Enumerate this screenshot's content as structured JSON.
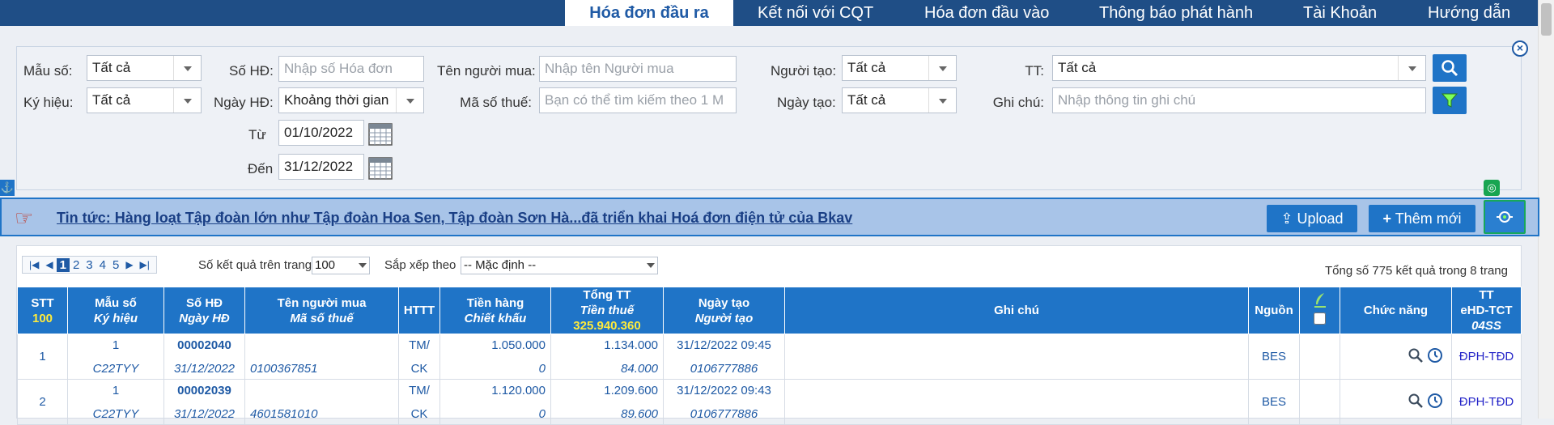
{
  "nav": {
    "tabs": [
      {
        "label": "Hóa đơn đầu ra",
        "active": true
      },
      {
        "label": "Kết nối với CQT"
      },
      {
        "label": "Hóa đơn đầu vào"
      },
      {
        "label": "Thông báo phát hành"
      },
      {
        "label": "Tài Khoản"
      },
      {
        "label": "Hướng dẫn"
      }
    ]
  },
  "filters": {
    "mau_so_label": "Mẫu số:",
    "mau_so_value": "Tất cả",
    "ky_hieu_label": "Ký hiệu:",
    "ky_hieu_value": "Tất cả",
    "so_hd_label": "Số HĐ:",
    "so_hd_placeholder": "Nhập số Hóa đơn",
    "ngay_hd_label": "Ngày HĐ:",
    "ngay_hd_value": "Khoảng thời gian",
    "tu_label": "Từ",
    "tu_value": "01/10/2022",
    "den_label": "Đến",
    "den_value": "31/12/2022",
    "ten_nguoi_mua_label": "Tên người mua:",
    "ten_nguoi_mua_placeholder": "Nhập tên Người mua",
    "ma_so_thue_label": "Mã số thuế:",
    "ma_so_thue_placeholder": "Bạn có thể tìm kiếm theo 1 M",
    "nguoi_tao_label": "Người tạo:",
    "nguoi_tao_value": "Tất cả",
    "ngay_tao_label": "Ngày tạo:",
    "ngay_tao_value": "Tất cả",
    "tt_label": "TT:",
    "tt_value": "Tất cả",
    "ghi_chu_label": "Ghi chú:",
    "ghi_chu_placeholder": "Nhập thông tin ghi chú"
  },
  "news": {
    "text": "Tin tức: Hàng loạt Tập đoàn lớn như Tập đoàn Hoa Sen, Tập đoàn Sơn Hà...đã triển khai Hoá đơn điện tử của Bkav"
  },
  "actions": {
    "upload_label": "Upload",
    "add_label": "Thêm mới"
  },
  "listing": {
    "pages": [
      "1",
      "2",
      "3",
      "4",
      "5"
    ],
    "current_page": "1",
    "per_page_label": "Số kết quả trên trang",
    "per_page_value": "100",
    "sort_label": "Sắp xếp theo",
    "sort_value": "-- Mặc định --",
    "total_text": "Tổng số 775 kết quả trong 8 trang"
  },
  "table": {
    "headers": {
      "stt": "STT",
      "stt_sub": "100",
      "mau_so": "Mẫu số",
      "ky_hieu": "Ký hiệu",
      "so_hd": "Số HĐ",
      "ngay_hd": "Ngày HĐ",
      "ten_nguoi_mua": "Tên người mua",
      "mst": "Mã số thuế",
      "httt": "HTTT",
      "tien_hang": "Tiền hàng",
      "chiet_khau": "Chiết khấu",
      "tong_tt": "Tổng TT",
      "tien_thue": "Tiền thuế",
      "tong_value": "325.940.360",
      "ngay_tao": "Ngày tạo",
      "nguoi_tao": "Người tạo",
      "ghi_chu": "Ghi chú",
      "nguon": "Nguồn",
      "chuc_nang": "Chức năng",
      "tt": "TT",
      "ehd": "eHD-TCT",
      "ss": "04SS"
    },
    "rows": [
      {
        "stt": "1",
        "mau_so": "1",
        "ky_hieu": "C22TYY",
        "so_hd": "00002040",
        "ngay_hd": "31/12/2022",
        "ten": "",
        "mst": "0100367851",
        "httt1": "TM/",
        "httt2": "CK",
        "tien_hang": "1.050.000",
        "chiet_khau": "0",
        "tong_tt": "1.134.000",
        "tien_thue": "84.000",
        "ngay_tao": "31/12/2022 09:45",
        "nguoi_tao": "0106777886",
        "ghi_chu": "",
        "nguon": "BES",
        "tt": "ĐPH-TĐD"
      },
      {
        "stt": "2",
        "mau_so": "1",
        "ky_hieu": "C22TYY",
        "so_hd": "00002039",
        "ngay_hd": "31/12/2022",
        "ten": "",
        "mst": "4601581010",
        "httt1": "TM/",
        "httt2": "CK",
        "tien_hang": "1.120.000",
        "chiet_khau": "0",
        "tong_tt": "1.209.600",
        "tien_thue": "89.600",
        "ngay_tao": "31/12/2022 09:43",
        "nguoi_tao": "0106777886",
        "ghi_chu": "",
        "nguon": "BES",
        "tt": "ĐPH-TĐD"
      }
    ]
  },
  "colors": {
    "nav_bg": "#1f4e86",
    "accent": "#1f74c7",
    "news_bg": "#a8c4e8",
    "highlight": "#ffeb3b"
  }
}
